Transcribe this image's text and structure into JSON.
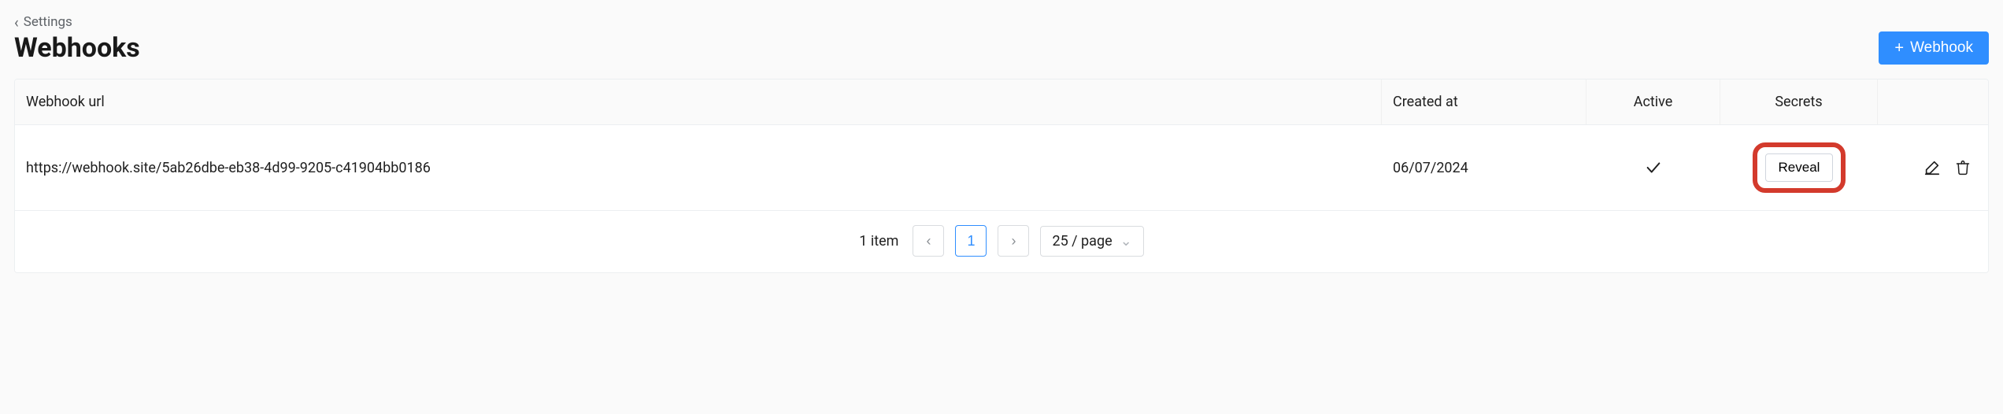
{
  "breadcrumb": {
    "label": "Settings"
  },
  "header": {
    "title": "Webhooks",
    "add_button_label": "Webhook"
  },
  "table": {
    "columns": {
      "url": "Webhook url",
      "created_at": "Created at",
      "active": "Active",
      "secrets": "Secrets"
    },
    "rows": [
      {
        "url": "https://webhook.site/5ab26dbe-eb38-4d99-9205-c41904bb0186",
        "created_at": "06/07/2024",
        "active": true,
        "reveal_label": "Reveal"
      }
    ]
  },
  "pagination": {
    "count_label": "1 item",
    "current_page": "1",
    "page_size_label": "25 / page"
  }
}
